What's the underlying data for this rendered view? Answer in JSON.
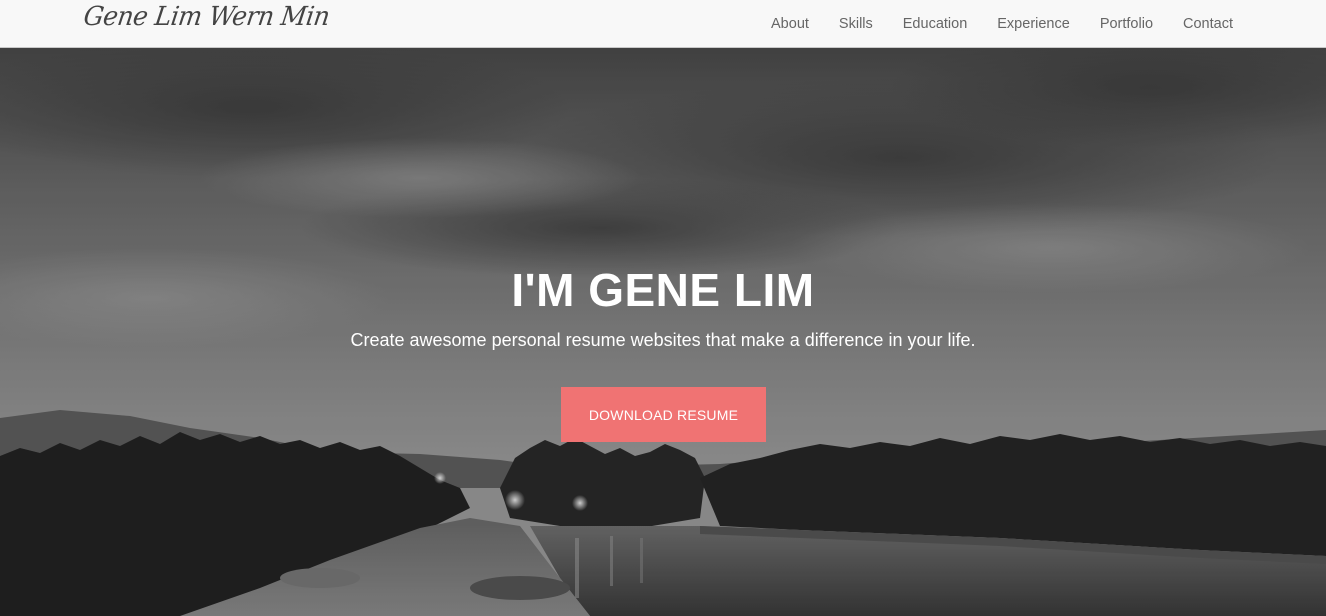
{
  "navbar": {
    "brand": "Gene Lim Wern Min",
    "links": [
      {
        "label": "About"
      },
      {
        "label": "Skills"
      },
      {
        "label": "Education"
      },
      {
        "label": "Experience"
      },
      {
        "label": "Portfolio"
      },
      {
        "label": "Contact"
      }
    ]
  },
  "hero": {
    "title": "I'M GENE LIM",
    "subtitle": "Create awesome personal resume websites that make a difference in your life.",
    "button_label": "DOWNLOAD RESUME",
    "background": "black and white landscape photo of a river at dusk with trees and a dirt path",
    "colors": {
      "accent": "#f07373",
      "navbar_bg": "#f8f8f8",
      "nav_text": "#666666"
    }
  }
}
